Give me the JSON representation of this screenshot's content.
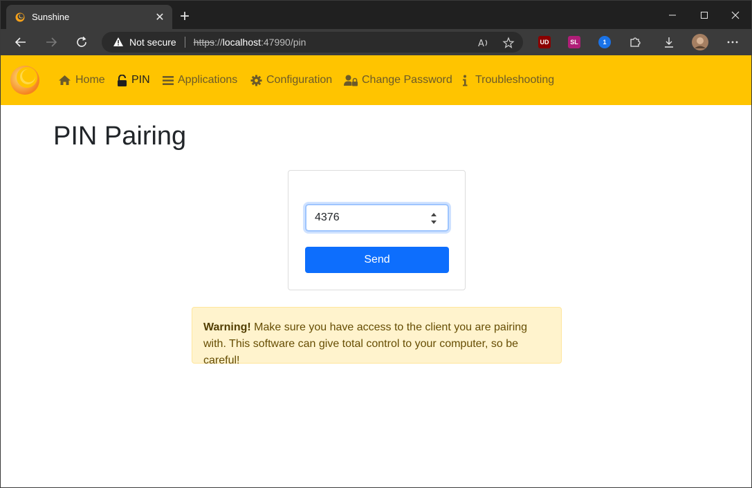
{
  "browser": {
    "tab_title": "Sunshine",
    "tab_close": "✕",
    "new_tab": "+",
    "security_label": "Not secure",
    "url_scheme": "https",
    "url_sep": "://",
    "url_host": "localhost",
    "url_rest": ":47990/pin",
    "extensions": [
      {
        "name": "ublock",
        "text": "UD",
        "color": "#8b0000"
      },
      {
        "name": "sl",
        "text": "SL",
        "color": "#b01e78"
      },
      {
        "name": "onepassword",
        "text": "1",
        "color": "#1a73e8"
      }
    ]
  },
  "navbar": {
    "items": [
      {
        "label": "Home",
        "icon": "home-icon",
        "active": false
      },
      {
        "label": "PIN",
        "icon": "lock-icon",
        "active": true
      },
      {
        "label": "Applications",
        "icon": "bars-icon",
        "active": false
      },
      {
        "label": "Configuration",
        "icon": "gear-icon",
        "active": false
      },
      {
        "label": "Change Password",
        "icon": "user-lock-icon",
        "active": false
      },
      {
        "label": "Troubleshooting",
        "icon": "info-icon",
        "active": false
      }
    ]
  },
  "main": {
    "title": "PIN Pairing",
    "pin_value": "4376",
    "send_label": "Send",
    "warning_strong": "Warning!",
    "warning_text": " Make sure you have access to the client you are pairing with. This software can give total control to your computer, so be careful!"
  },
  "colors": {
    "navbar_bg": "#ffc400",
    "primary": "#0d6efd",
    "warning_bg": "#fff3cd"
  }
}
